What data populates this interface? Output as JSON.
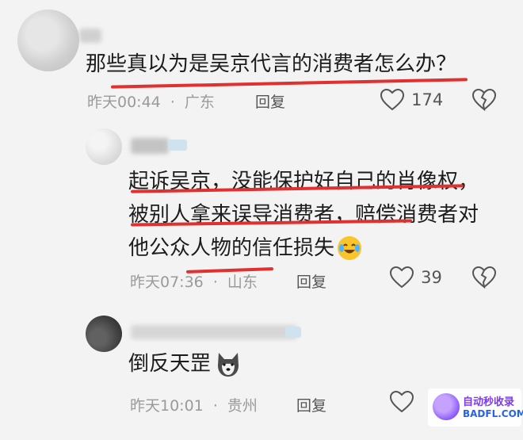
{
  "comments": [
    {
      "text": "那些真以为是吴京代言的消费者怎么办？",
      "time": "昨天00:44",
      "location": "广东",
      "reply_label": "回复",
      "likes": "174"
    },
    {
      "lines": [
        "起诉吴京，没能保护好自己的肖像权，",
        "被别人拿来误导消费者，赔偿消费者对",
        "他公众人物的信任损失"
      ],
      "emoji": "laughing-crying-emoji",
      "time": "昨天07:36",
      "location": "山东",
      "reply_label": "回复",
      "likes": "39"
    },
    {
      "text": "倒反天罡",
      "emoji": "dog-emoji",
      "time": "昨天10:01",
      "location": "贵州",
      "reply_label": "回复",
      "likes": ""
    }
  ],
  "separator": "·",
  "watermark": {
    "line1": "自动秒收录",
    "line2": "BADFL.COM"
  },
  "colors": {
    "underline": "#e0302f",
    "meta_text": "#9a9a9a",
    "background": "#f3f3f3"
  }
}
